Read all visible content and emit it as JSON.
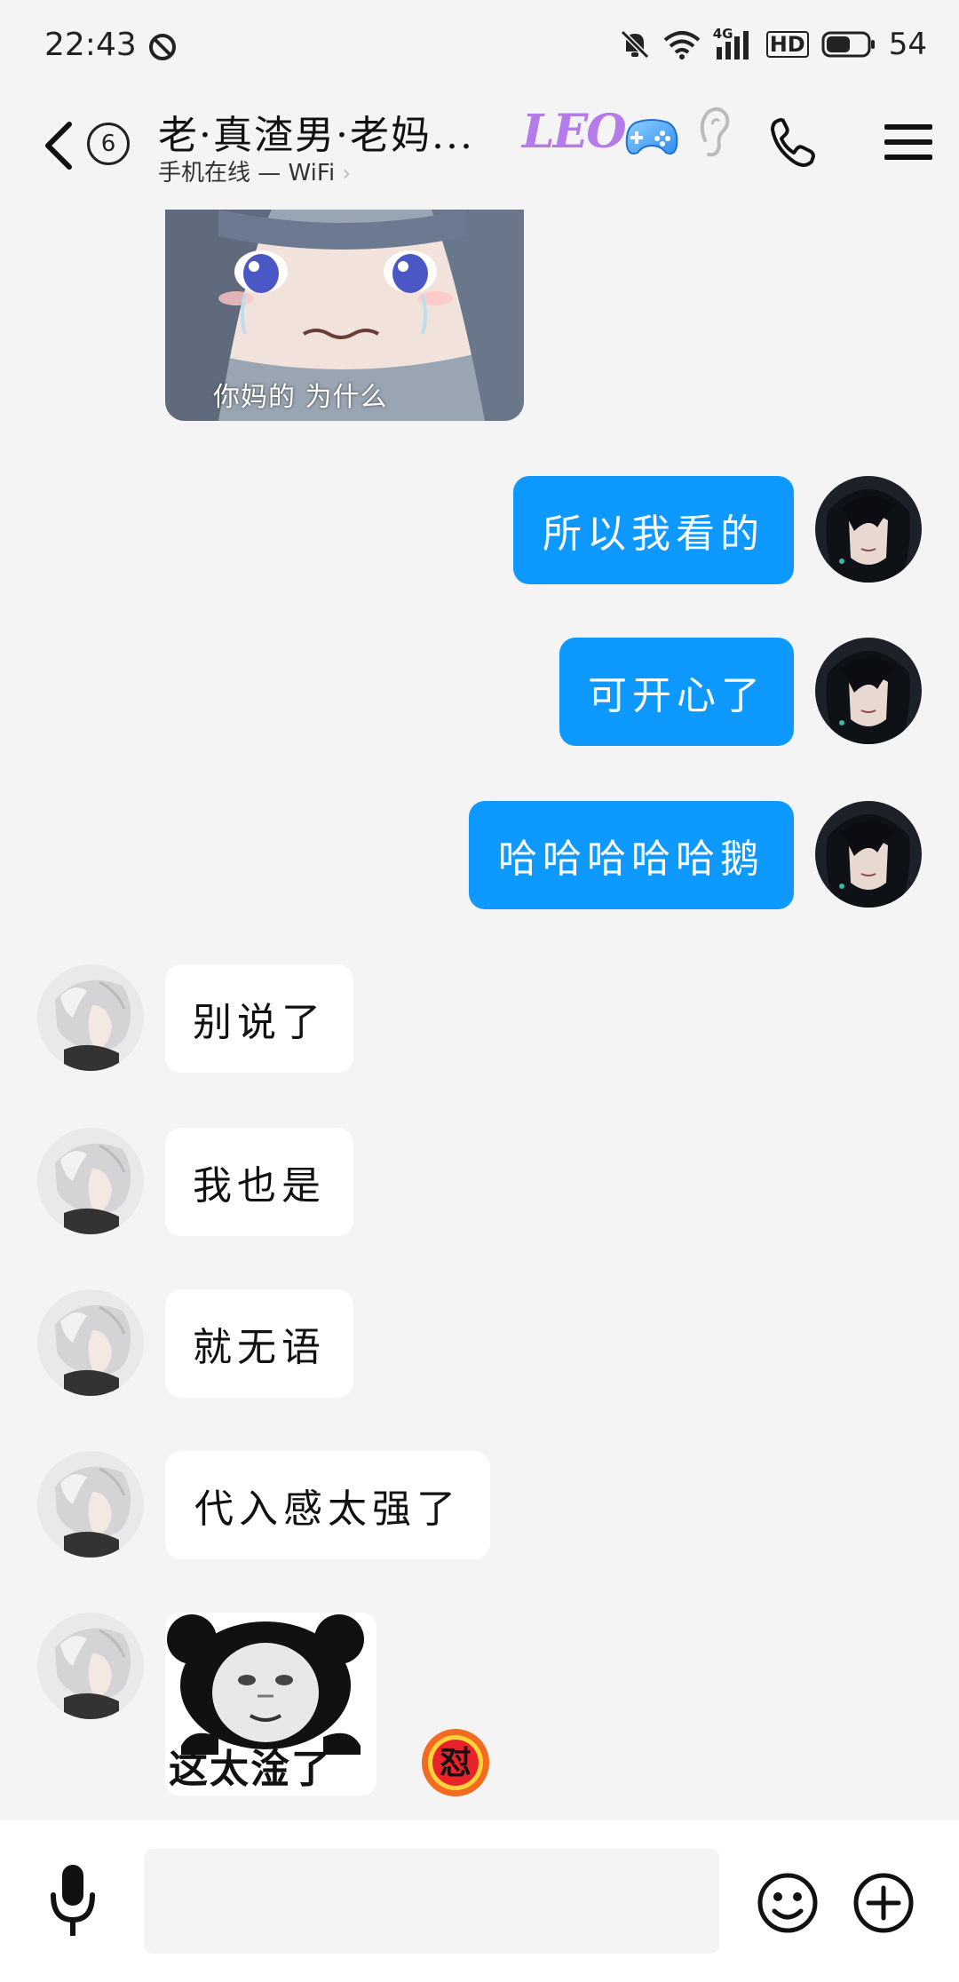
{
  "status_bar": {
    "time": "22:43",
    "network_label": "4G",
    "hd_label": "HD",
    "battery_level": "54"
  },
  "header": {
    "unread_count": "6",
    "title": "老·真渣男·老妈...",
    "subtitle": "手机在线 — WiFi",
    "subtitle_chevron": "›",
    "tag_label": "LEO"
  },
  "messages": [
    {
      "side": "in",
      "kind": "image",
      "caption": "你妈的 为什么"
    },
    {
      "side": "out",
      "kind": "text",
      "text": "所以我看的"
    },
    {
      "side": "out",
      "kind": "text",
      "text": "可开心了"
    },
    {
      "side": "out",
      "kind": "text",
      "text": "哈哈哈哈哈鹅"
    },
    {
      "side": "in",
      "kind": "text",
      "text": "别说了"
    },
    {
      "side": "in",
      "kind": "text",
      "text": "我也是"
    },
    {
      "side": "in",
      "kind": "text",
      "text": "就无语"
    },
    {
      "side": "in",
      "kind": "text",
      "text": "代入感太强了"
    },
    {
      "side": "in",
      "kind": "sticker",
      "caption": "这太淦了",
      "reaction": "怼"
    }
  ],
  "input": {
    "placeholder": ""
  },
  "icons": {
    "back": "back-chevron-icon",
    "dnd": "do-not-disturb-icon",
    "mute": "mute-bell-icon",
    "wifi": "wifi-icon",
    "signal": "signal-icon",
    "battery": "battery-icon",
    "gamepad": "gamepad-icon",
    "ear": "ear-icon",
    "phone": "phone-icon",
    "menu": "menu-icon",
    "mic": "microphone-icon",
    "emoji": "emoji-icon",
    "plus": "plus-icon"
  },
  "colors": {
    "accent": "#0d99ff",
    "background": "#f4f4f4",
    "bubble_in": "#ffffff",
    "tag": "#b57be8"
  }
}
